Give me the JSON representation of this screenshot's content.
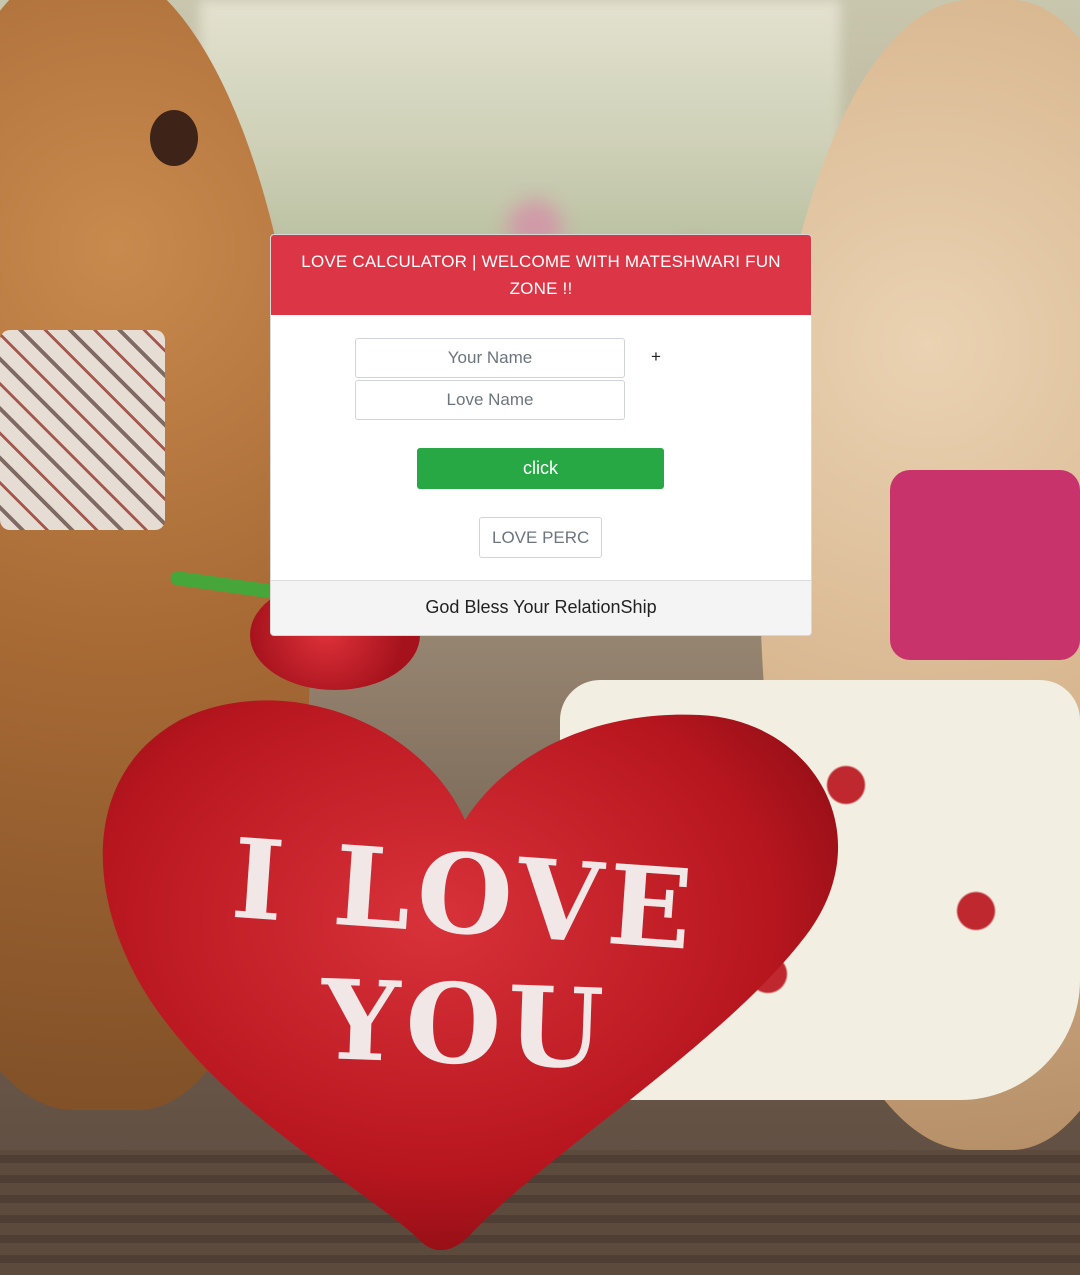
{
  "background": {
    "heart_text_line1": "I LOVE",
    "heart_text_line2": "YOU"
  },
  "card": {
    "header_title": "LOVE CALCULATOR | WELCOME WITH MATESHWARI FUN ZONE !!",
    "your_name_placeholder": "Your Name",
    "plus_sign": "+",
    "love_name_placeholder": "Love Name",
    "click_label": "click",
    "percent_placeholder": "LOVE PERCENTAGE",
    "footer_text": "God Bless Your RelationShip"
  },
  "colors": {
    "header": "#dc3545",
    "button": "#28a745"
  }
}
